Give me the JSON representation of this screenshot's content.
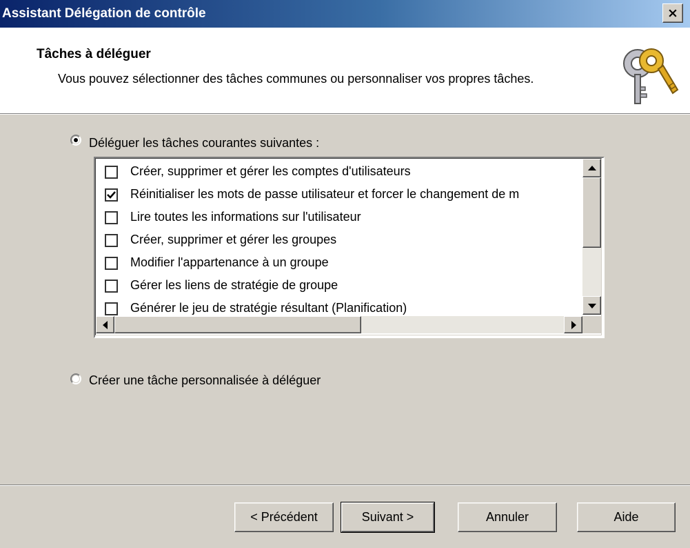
{
  "window": {
    "title": "Assistant Délégation de contrôle",
    "close_glyph": "×"
  },
  "header": {
    "title": "Tâches à déléguer",
    "subtitle": "Vous pouvez sélectionner des tâches communes ou personnaliser vos propres tâches.",
    "icon": "keys-icon"
  },
  "options": {
    "common": {
      "label": "Déléguer les tâches courantes suivantes :",
      "selected": true
    },
    "custom": {
      "label": "Créer une tâche personnalisée à déléguer",
      "selected": false
    }
  },
  "tasks": [
    {
      "label": "Créer, supprimer et gérer les comptes d'utilisateurs",
      "checked": false
    },
    {
      "label": "Réinitialiser les mots de passe utilisateur et forcer le changement de m",
      "checked": true
    },
    {
      "label": "Lire toutes les informations sur l'utilisateur",
      "checked": false
    },
    {
      "label": "Créer, supprimer et gérer les groupes",
      "checked": false
    },
    {
      "label": "Modifier l'appartenance à un groupe",
      "checked": false
    },
    {
      "label": "Gérer les liens de stratégie de groupe",
      "checked": false
    },
    {
      "label": "Générer le jeu de stratégie résultant (Planification)",
      "checked": false
    }
  ],
  "buttons": {
    "back": "< Précédent",
    "next": "Suivant >",
    "cancel": "Annuler",
    "help": "Aide"
  },
  "colors": {
    "titlebar_start": "#0a246a",
    "titlebar_end": "#a6caf0",
    "dialog_bg": "#d4d0c8",
    "header_bg": "#ffffff"
  }
}
